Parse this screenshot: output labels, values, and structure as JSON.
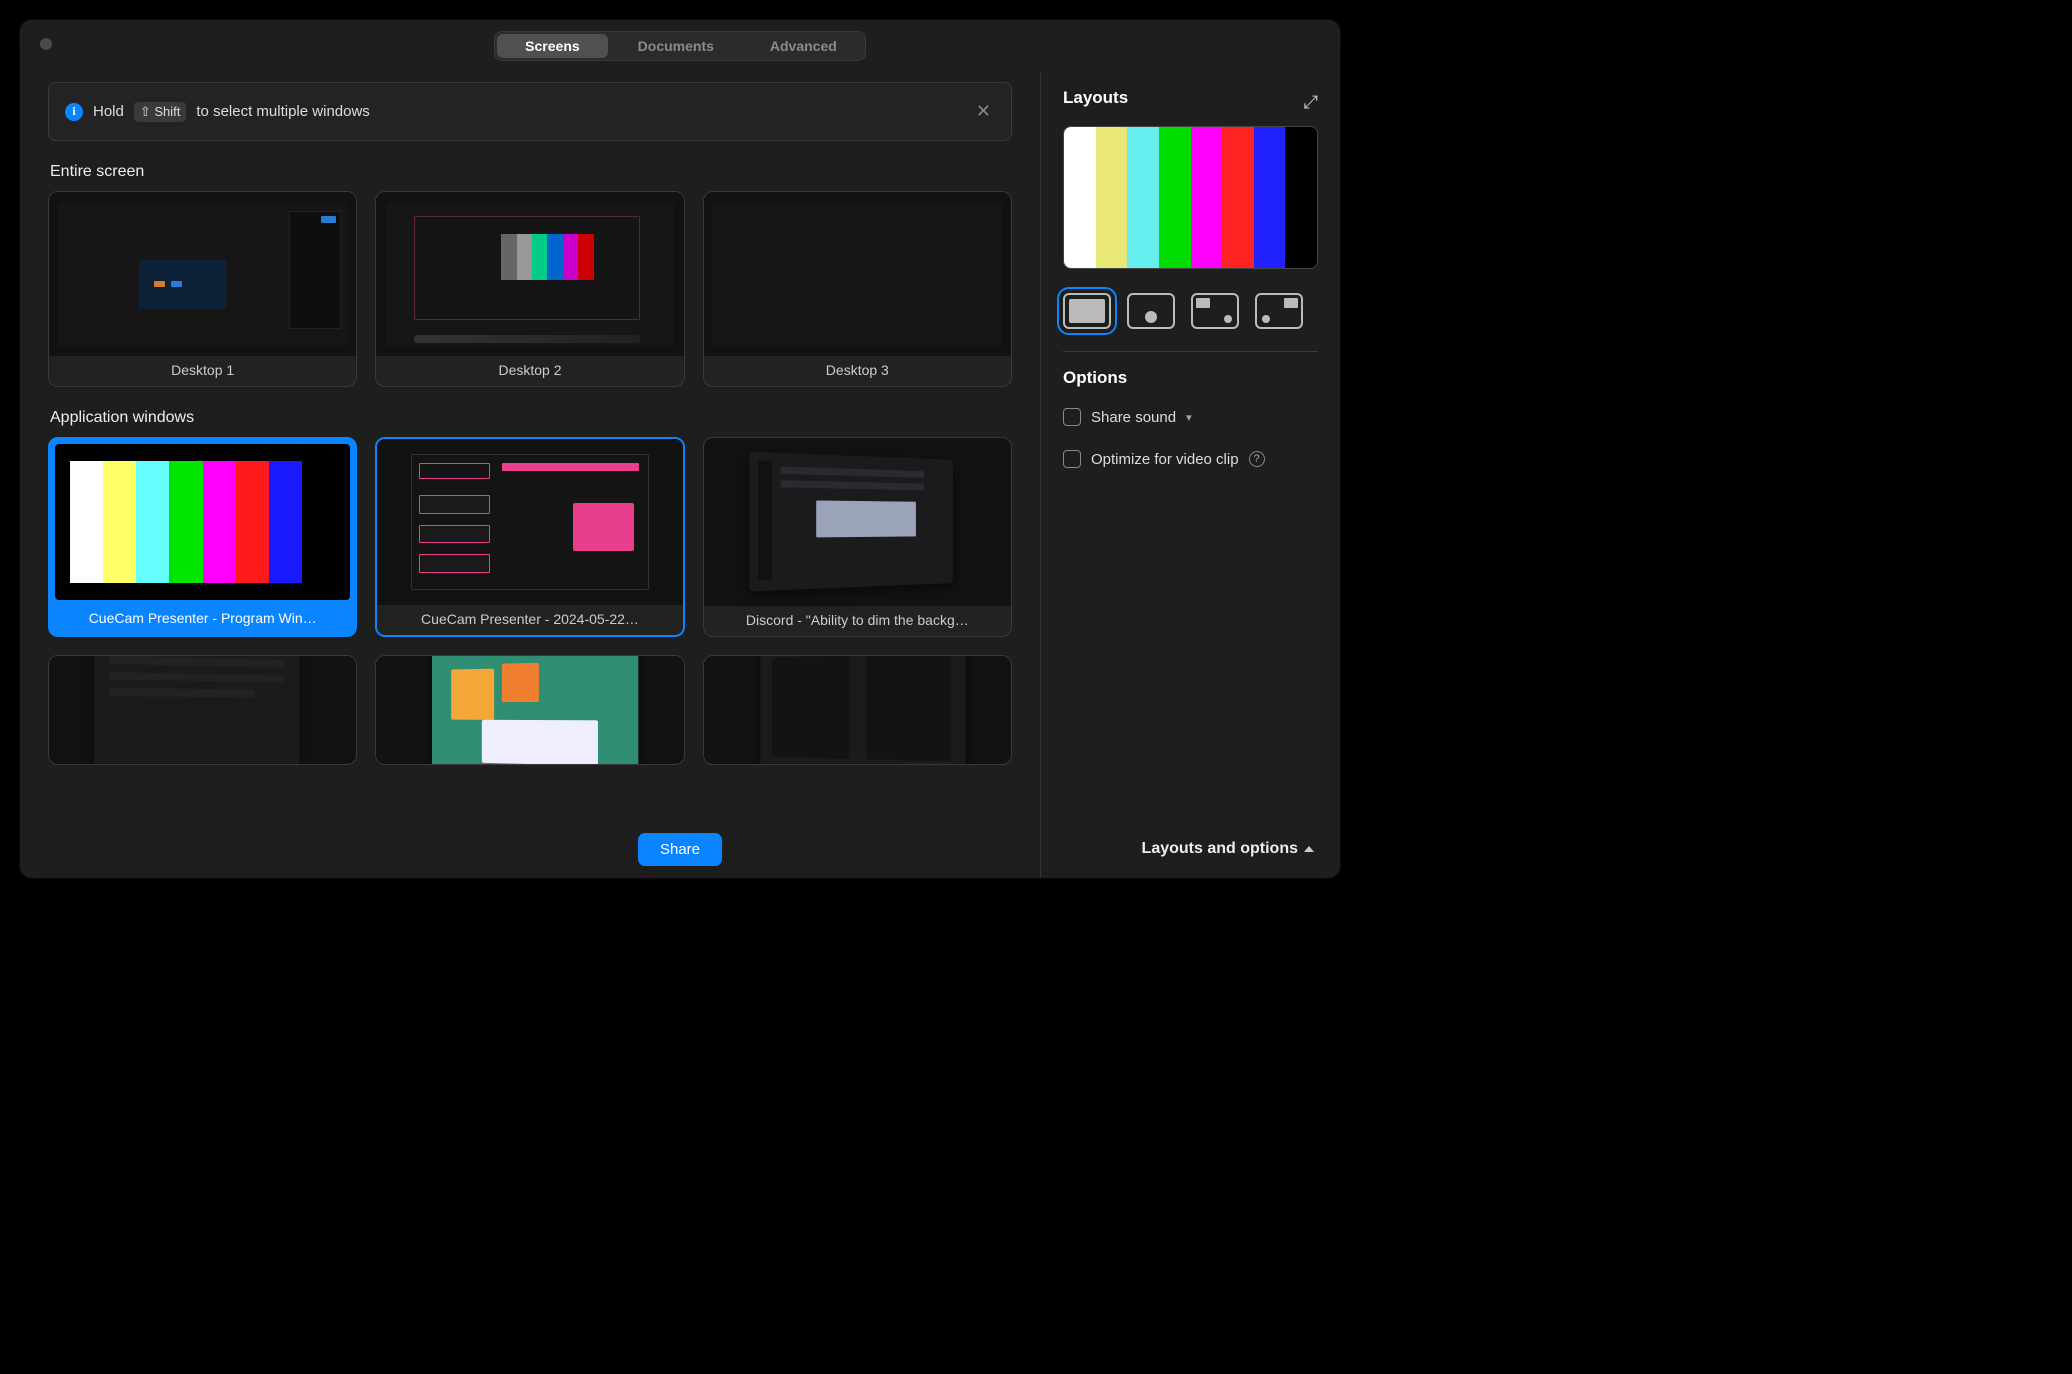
{
  "tabs": {
    "screens": "Screens",
    "documents": "Documents",
    "advanced": "Advanced"
  },
  "info": {
    "pre": "Hold",
    "key": "⇧ Shift",
    "post": "to select multiple windows"
  },
  "sections": {
    "entire": "Entire screen",
    "apps": "Application windows"
  },
  "desktops": [
    "Desktop 1",
    "Desktop 2",
    "Desktop 3"
  ],
  "windows": [
    "CueCam Presenter - Program Win…",
    "CueCam Presenter - 2024-05-22…",
    "Discord - \"Ability to dim the backg…"
  ],
  "sidebar": {
    "layouts": "Layouts",
    "options": "Options",
    "share_sound": "Share sound",
    "optimize": "Optimize for video clip"
  },
  "footer": {
    "share": "Share",
    "toggle": "Layouts and options"
  },
  "colors": {
    "accent": "#0a84ff"
  }
}
